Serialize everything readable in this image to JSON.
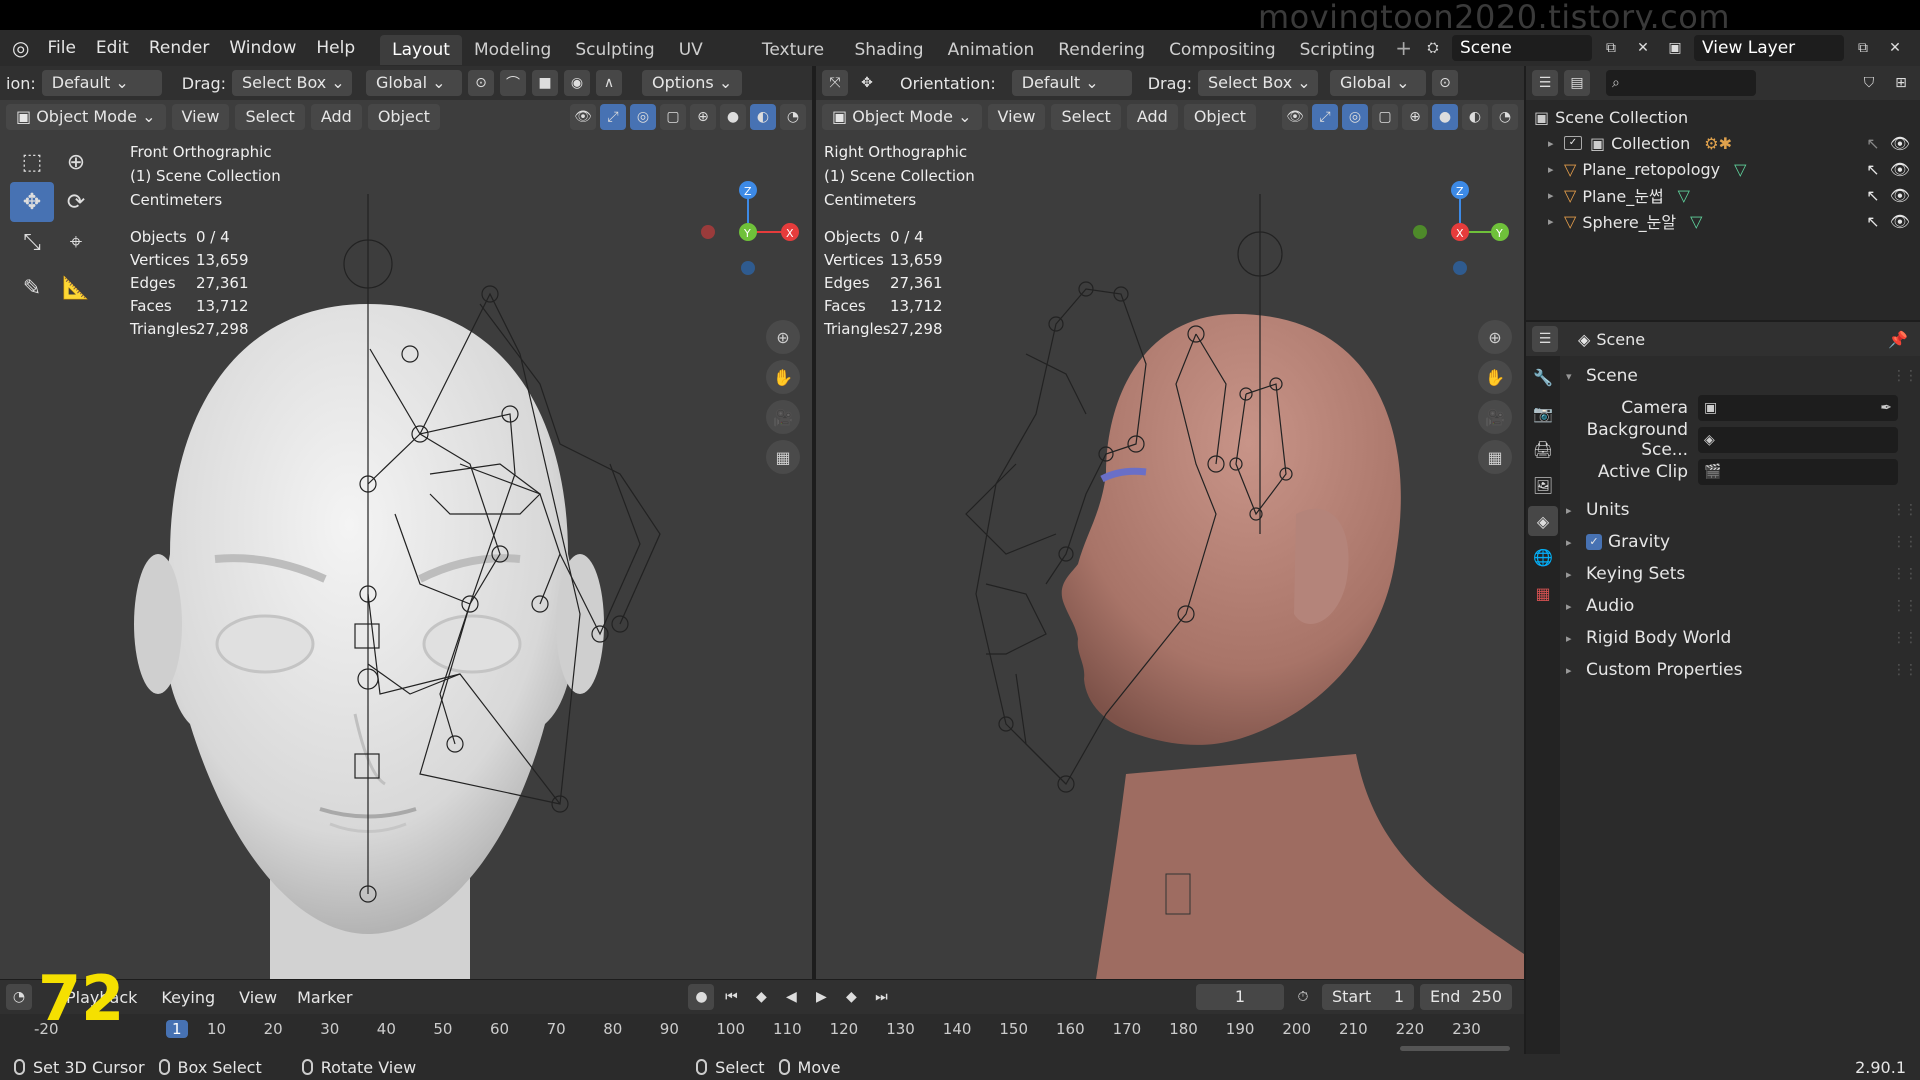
{
  "watermark": "movingtoon2020.tistory.com",
  "menu": [
    "File",
    "Edit",
    "Render",
    "Window",
    "Help"
  ],
  "workspaces": [
    {
      "label": "Layout",
      "active": true
    },
    {
      "label": "Modeling"
    },
    {
      "label": "Sculpting"
    },
    {
      "label": "UV Editing"
    },
    {
      "label": "Texture Paint"
    },
    {
      "label": "Shading"
    },
    {
      "label": "Animation"
    },
    {
      "label": "Rendering"
    },
    {
      "label": "Compositing"
    },
    {
      "label": "Scripting"
    }
  ],
  "scene_name": "Scene",
  "view_layer": "View Layer",
  "left_tool_header": {
    "orientation_label": "ion:",
    "orientation": "Default",
    "drag_label": "Drag:",
    "drag": "Select Box",
    "transform": "Global",
    "options": "Options"
  },
  "right_tool_header": {
    "orientation_label": "Orientation:",
    "orientation": "Default",
    "drag_label": "Drag:",
    "drag": "Select Box",
    "transform": "Global"
  },
  "viewport_header": {
    "mode": "Object Mode",
    "view": "View",
    "select": "Select",
    "add": "Add",
    "object": "Object"
  },
  "left_viewport": {
    "title": "Front Orthographic",
    "collection": "(1) Scene Collection",
    "units": "Centimeters",
    "stats": {
      "objects": "0 / 4",
      "vertices": "13,659",
      "edges": "27,361",
      "faces": "13,712",
      "triangles": "27,298"
    }
  },
  "right_viewport": {
    "title": "Right Orthographic",
    "collection": "(1) Scene Collection",
    "units": "Centimeters",
    "stats": {
      "objects": "0 / 4",
      "vertices": "13,659",
      "edges": "27,361",
      "faces": "13,712",
      "triangles": "27,298"
    }
  },
  "stat_labels": {
    "objects": "Objects",
    "vertices": "Vertices",
    "edges": "Edges",
    "faces": "Faces",
    "triangles": "Triangles"
  },
  "gizmo": {
    "z": "Z",
    "y": "Y",
    "x": "X"
  },
  "outliner": {
    "root": "Scene Collection",
    "items": [
      {
        "label": "Collection",
        "type": "collection"
      },
      {
        "label": "Plane_retopology",
        "type": "object"
      },
      {
        "label": "Plane_눈썹",
        "type": "object"
      },
      {
        "label": "Sphere_눈알",
        "type": "object"
      }
    ]
  },
  "properties": {
    "header": "Scene",
    "panel_title": "Scene",
    "fields": [
      {
        "label": "Camera"
      },
      {
        "label": "Background Sce..."
      },
      {
        "label": "Active Clip"
      }
    ],
    "subpanels": [
      "Units",
      "Gravity",
      "Keying Sets",
      "Audio",
      "Rigid Body World",
      "Custom Properties"
    ],
    "gravity_checked": true
  },
  "timeline": {
    "playback": "Playback",
    "keying": "Keying",
    "view": "View",
    "marker": "Marker",
    "current_frame": "1",
    "start_label": "Start",
    "start": "1",
    "end_label": "End",
    "end": "250",
    "ticks": [
      "-20",
      "1",
      "10",
      "20",
      "30",
      "40",
      "50",
      "60",
      "70",
      "80",
      "90",
      "100",
      "110",
      "120",
      "130",
      "140",
      "150",
      "160",
      "170",
      "180",
      "190",
      "200",
      "210",
      "220",
      "230"
    ],
    "overlay_number": "72"
  },
  "statusbar": {
    "items": [
      "Set 3D Cursor",
      "Box Select",
      "Rotate View",
      "Select",
      "Move"
    ],
    "version": "2.90.1"
  },
  "colors": {
    "accent": "#4772b3",
    "x_axis": "#e63c3c",
    "y_axis": "#6fc13a",
    "z_axis": "#3d8ae6",
    "skin": "#b27e73",
    "white_mesh": "#e8e8e8"
  }
}
